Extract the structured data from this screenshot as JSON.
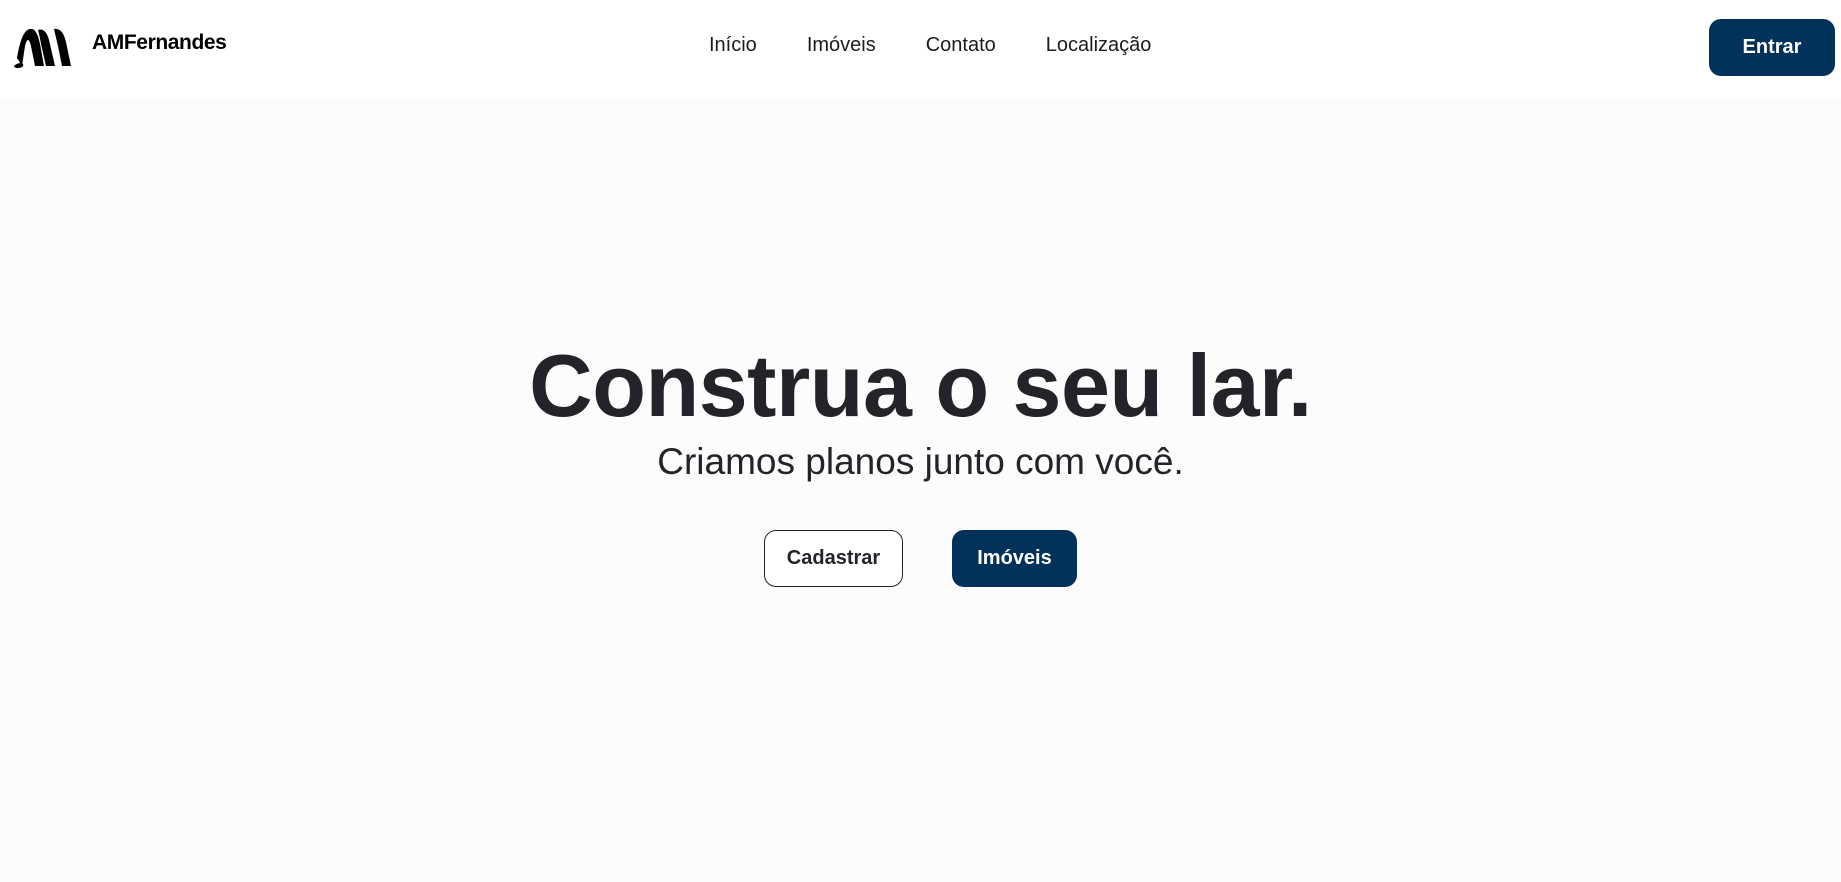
{
  "header": {
    "logo_text": "AMFernandes",
    "nav": [
      {
        "label": "Início"
      },
      {
        "label": "Imóveis"
      },
      {
        "label": "Contato"
      },
      {
        "label": "Localização"
      }
    ],
    "login_label": "Entrar"
  },
  "hero": {
    "title": "Construa o seu lar.",
    "subtitle": "Criamos planos junto com você.",
    "register_label": "Cadastrar",
    "properties_label": "Imóveis"
  },
  "colors": {
    "primary": "#02325a",
    "text": "#222429",
    "background": "#fcfcfc",
    "header_background": "#ffffff"
  }
}
